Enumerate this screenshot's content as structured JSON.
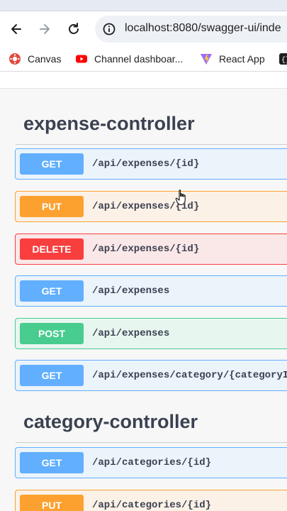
{
  "browser": {
    "url": "localhost:8080/swagger-ui/inde",
    "bookmarks": [
      {
        "label": "Canvas",
        "icon": "canvas-icon"
      },
      {
        "label": "Channel dashboar...",
        "icon": "youtube-icon"
      },
      {
        "label": "React App",
        "icon": "vite-icon"
      }
    ]
  },
  "sections": [
    {
      "title": "expense-controller",
      "operations": [
        {
          "method": "GET",
          "path": "/api/expenses/{id}"
        },
        {
          "method": "PUT",
          "path": "/api/expenses/{id}"
        },
        {
          "method": "DELETE",
          "path": "/api/expenses/{id}"
        },
        {
          "method": "GET",
          "path": "/api/expenses"
        },
        {
          "method": "POST",
          "path": "/api/expenses"
        },
        {
          "method": "GET",
          "path": "/api/expenses/category/{categoryId}"
        }
      ]
    },
    {
      "title": "category-controller",
      "operations": [
        {
          "method": "GET",
          "path": "/api/categories/{id}"
        },
        {
          "method": "PUT",
          "path": "/api/categories/{id}"
        }
      ]
    }
  ],
  "colors": {
    "get": "#61affe",
    "put": "#fca130",
    "delete": "#f93e3e",
    "post": "#49cc90"
  }
}
